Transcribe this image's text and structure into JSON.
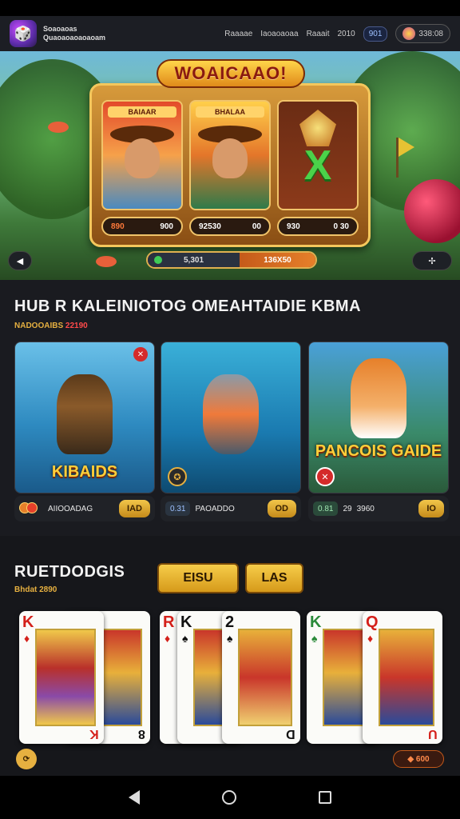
{
  "topbar": {
    "brand_line1": "Soaoaoas",
    "brand_line2": "Quaoaoaoaoaoam",
    "nav1": "Raaaae",
    "nav2": "Iaoaoaoaa",
    "nav3": "Raaait",
    "nav4": "2010",
    "pill": "901",
    "balance": "338:08"
  },
  "hero": {
    "machine_title": "WOAICAAO!",
    "reel1_label": "BAIAAR",
    "reel2_label": "BHALAA",
    "reel3_symbol": "X",
    "bar1_left": "890",
    "bar1_right": "900",
    "bar2_left": "92530",
    "bar2_right": "00",
    "bar3_left": "930",
    "bar3_right": "0  30",
    "progress_left": "5,301",
    "progress_right": "136X50",
    "nav_left": "◀",
    "nav_right": "✢"
  },
  "section1": {
    "title": "HUB R KALEINIOTOG OMEAHTAIDIE KBMA",
    "subtitle_text": "NADOOAIBS",
    "subtitle_value": "22190",
    "cards": [
      {
        "title": "KIBAIDS",
        "foot_label": "AIIOOADAG",
        "button": "IAD"
      },
      {
        "title": "",
        "foot_chip": "0.31",
        "foot_label": "PAOADDO",
        "button": "OD"
      },
      {
        "title": "PANCOIS GAIDE",
        "foot_chip": "0.81",
        "foot_label": "29",
        "foot_value": "3960",
        "button": "IO"
      }
    ]
  },
  "section2": {
    "title": "RUETDODGIS",
    "subtitle": "Bhdat 2890",
    "tab1": "EISU",
    "tab2": "LAS",
    "cards": [
      {
        "rank": "K",
        "suit": "♦",
        "rank2": "K"
      },
      {
        "rank": "K",
        "suit": "♦",
        "rank2": "8"
      },
      {
        "rank": "R",
        "suit": "♦",
        "rank2": "R"
      },
      {
        "rank": "K",
        "suit": "♠",
        "rank2": "K"
      },
      {
        "rank": "2",
        "suit": "♠",
        "rank2": "D"
      },
      {
        "rank": "K",
        "suit": "♠",
        "rank2": "K"
      },
      {
        "rank": "Q",
        "suit": "♦",
        "rank2": "U"
      }
    ],
    "coin_left": "⟳",
    "coin_right": "◆ 600"
  },
  "colors": {
    "accent": "#e6b040",
    "bg": "#15171c",
    "green": "#3ecb57"
  }
}
